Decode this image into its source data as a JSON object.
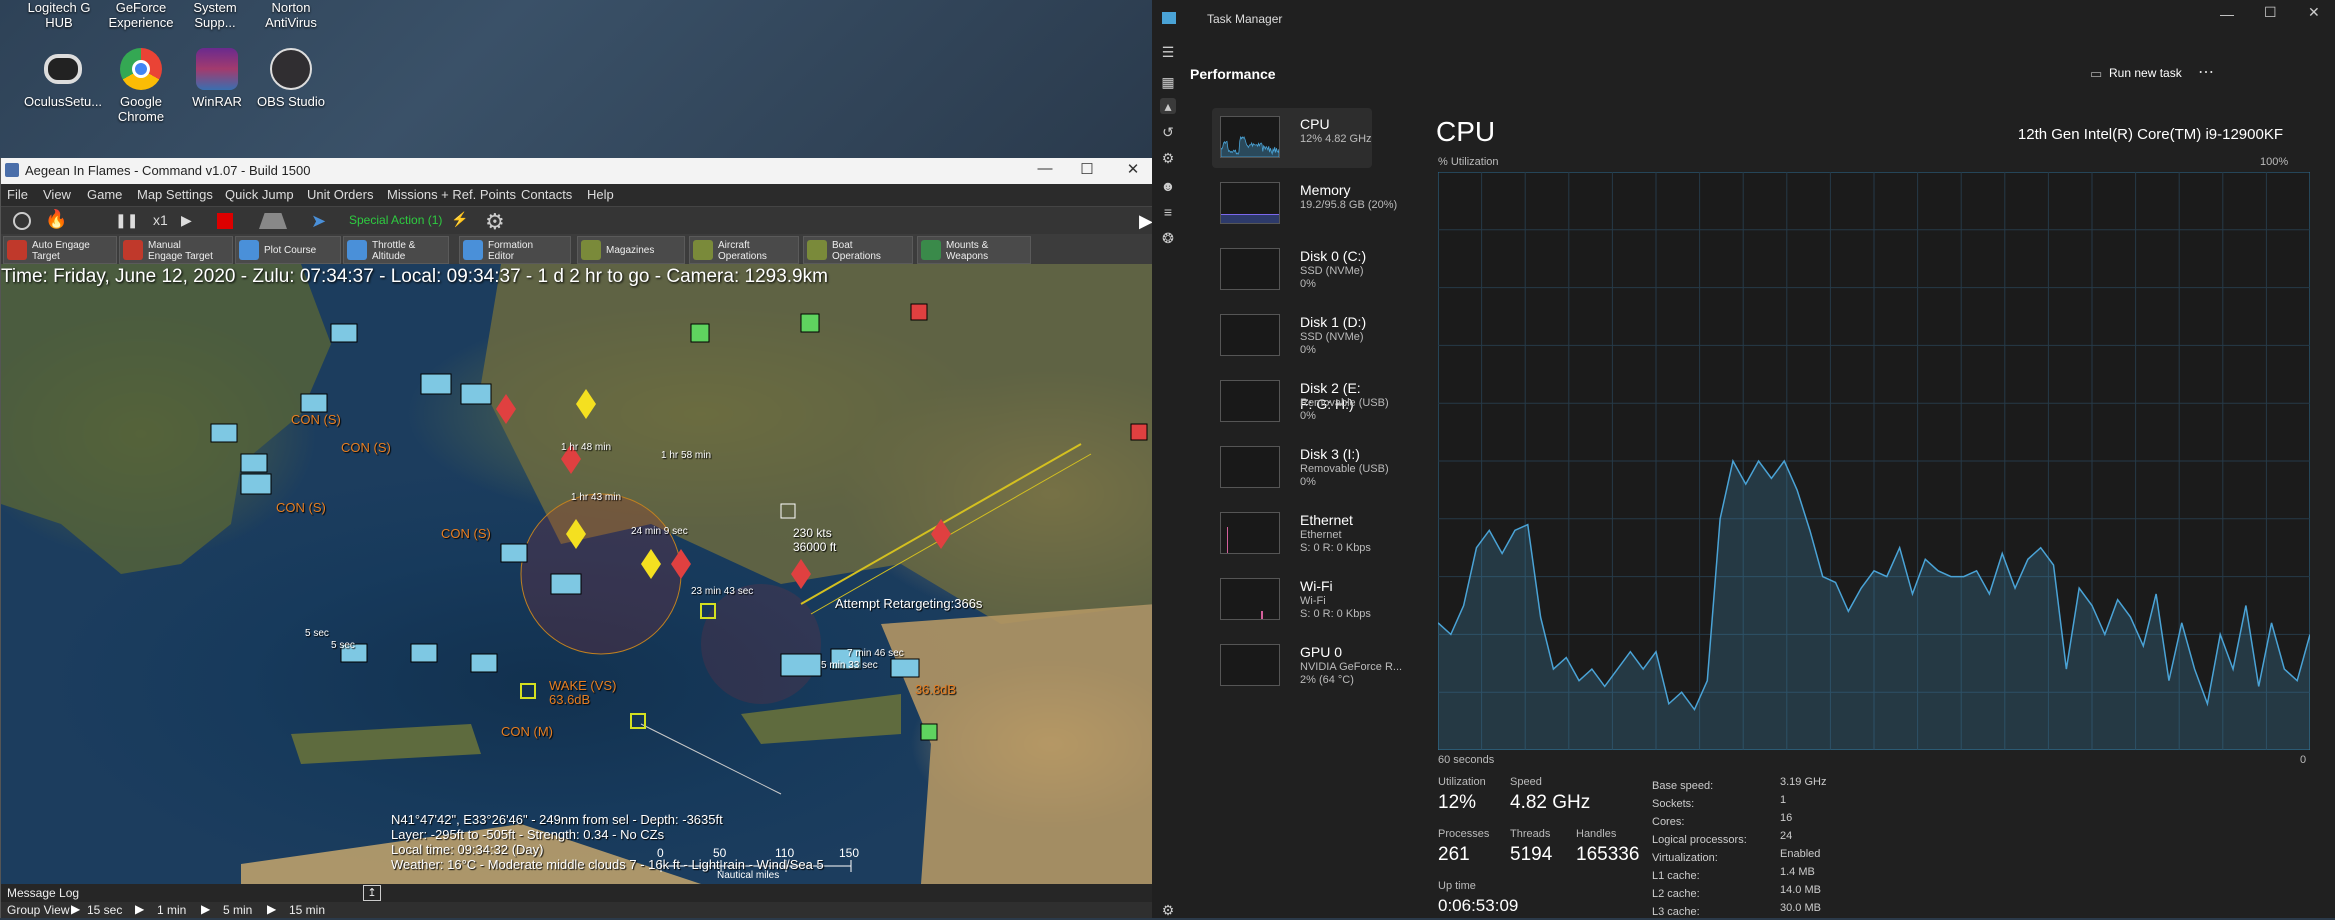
{
  "desktop": {
    "top_icons": [
      "Logitech G HUB",
      "GeForce Experience",
      "System Supp...",
      "Norton AntiVirus"
    ],
    "icons": [
      {
        "label": "OculusSetu...",
        "color": "#e7e7e7"
      },
      {
        "label": "Google Chrome",
        "color": "#4285f4"
      },
      {
        "label": "WinRAR",
        "color": "#8b2a7e"
      },
      {
        "label": "OBS Studio",
        "color": "#303030"
      }
    ]
  },
  "game": {
    "title": "Aegean In Flames - Command v1.07 - Build 1500",
    "menu": [
      "File",
      "View",
      "Game",
      "Map Settings",
      "Quick Jump",
      "Unit Orders",
      "Missions + Ref. Points",
      "Contacts",
      "Help"
    ],
    "speed_label": "x1",
    "special_action": "Special Action (1)",
    "toolbar2": [
      {
        "label": "Auto Engage\nTarget",
        "color": "#c0392b"
      },
      {
        "label": "Manual\nEngage Target",
        "color": "#c0392b"
      },
      {
        "label": "Plot Course",
        "color": "#4a90d9"
      },
      {
        "label": "Throttle &\nAltitude",
        "color": "#4a90d9"
      },
      {
        "label": "Formation\nEditor",
        "color": "#4a90d9"
      },
      {
        "label": "Magazines",
        "color": "#7a8a3a"
      },
      {
        "label": "Aircraft\nOperations",
        "color": "#7a8a3a"
      },
      {
        "label": "Boat\nOperations",
        "color": "#7a8a3a"
      },
      {
        "label": "Mounts &\nWeapons",
        "color": "#3a8a4a"
      }
    ],
    "time_line": "Time: Friday, June 12, 2020 - Zulu: 07:34:37 - Local: 09:34:37 - 1 d 2 hr to go - Camera: 1293.9km",
    "map_labels": [
      {
        "text": "CON (S)",
        "color": "#e67e22"
      },
      {
        "text": "CON (S)",
        "color": "#e67e22"
      },
      {
        "text": "CON (S)",
        "color": "#e67e22"
      },
      {
        "text": "CON (S)",
        "color": "#e67e22"
      },
      {
        "text": "WAKE (VS)",
        "color": "#e67e22"
      },
      {
        "text": "63.6dB",
        "color": "#e67e22"
      },
      {
        "text": "CON (M)",
        "color": "#e67e22"
      },
      {
        "text": "36.8dB",
        "color": "#e67e22"
      },
      {
        "text": "1 hr 48 min",
        "color": "#ffffff"
      },
      {
        "text": "1 hr 58 min",
        "color": "#ffffff"
      },
      {
        "text": "1 hr 43 min",
        "color": "#ffffff"
      },
      {
        "text": "24 min 9 sec",
        "color": "#ffffff"
      },
      {
        "text": "23 min 43 sec",
        "color": "#ffffff"
      },
      {
        "text": "230 kts",
        "color": "#ffffff"
      },
      {
        "text": "36000 ft",
        "color": "#ffffff"
      },
      {
        "text": "Attempt Retargeting:366s",
        "color": "#ffffff"
      },
      {
        "text": "7 min 46 sec",
        "color": "#ffffff"
      },
      {
        "text": "5 min 33 sec",
        "color": "#ffffff"
      },
      {
        "text": "5 sec",
        "color": "#ffffff"
      },
      {
        "text": "5 sec",
        "color": "#ffffff"
      }
    ],
    "info_lines": [
      "N41°47'42\", E33°26'46\" - 249nm from sel - Depth: -3635ft",
      "Layer: -295ft to -505ft - Strength: 0.34 - No CZs",
      "Local time: 09:34:32 (Day)",
      "Weather: 16°C - Moderate middle clouds 7 - 16k ft - Light rain - Wind/Sea 5"
    ],
    "scale_labels": [
      "0",
      "50",
      "110",
      "150"
    ],
    "scale_unit": "Nautical miles",
    "message_log": "Message Log",
    "group_view": "Group View",
    "time_steps": [
      "15 sec",
      "1 min",
      "5 min",
      "15 min"
    ]
  },
  "taskmgr": {
    "title": "Task Manager",
    "section": "Performance",
    "run_new_task": "Run new task",
    "resources": [
      {
        "name": "CPU",
        "s1": "12% 4.82 GHz",
        "s2": "",
        "color": "#4aa3d6",
        "selected": true
      },
      {
        "name": "Memory",
        "s1": "19.2/95.8 GB (20%)",
        "s2": "",
        "color": "#7b68ee",
        "selected": false
      },
      {
        "name": "Disk 0 (C:)",
        "s1": "SSD (NVMe)",
        "s2": "0%",
        "color": "#6aa84f",
        "selected": false
      },
      {
        "name": "Disk 1 (D:)",
        "s1": "SSD (NVMe)",
        "s2": "0%",
        "color": "#6aa84f",
        "selected": false
      },
      {
        "name": "Disk 2 (E: F: G: H:)",
        "s1": "Removable (USB)",
        "s2": "0%",
        "color": "#6aa84f",
        "selected": false
      },
      {
        "name": "Disk 3 (I:)",
        "s1": "Removable (USB)",
        "s2": "0%",
        "color": "#6aa84f",
        "selected": false
      },
      {
        "name": "Ethernet",
        "s1": "Ethernet",
        "s2": "S: 0 R: 0 Kbps",
        "color": "#d45f9b",
        "selected": false
      },
      {
        "name": "Wi-Fi",
        "s1": "Wi-Fi",
        "s2": "S: 0 R: 0 Kbps",
        "color": "#d45f9b",
        "selected": false
      },
      {
        "name": "GPU 0",
        "s1": "NVIDIA GeForce R...",
        "s2": "2% (64 °C)",
        "color": "#4aa3d6",
        "selected": false
      }
    ],
    "cpu": {
      "heading": "CPU",
      "model": "12th Gen Intel(R) Core(TM) i9-12900KF",
      "util_label": "% Utilization",
      "max_label": "100%",
      "time_label": "60 seconds",
      "min_label": "0",
      "history": [
        22,
        20,
        25,
        35,
        38,
        34,
        38,
        39,
        23,
        14,
        16,
        12,
        14,
        11,
        14,
        17,
        14,
        17,
        8,
        10,
        7,
        12,
        40,
        50,
        46,
        50,
        47,
        50,
        45,
        38,
        30,
        29,
        24,
        28,
        31,
        30,
        35,
        27,
        33,
        31,
        30,
        30,
        31,
        27,
        34,
        28,
        33,
        35,
        32,
        14,
        28,
        25,
        20,
        26,
        23,
        18,
        27,
        12,
        22,
        14,
        8,
        20,
        14,
        25,
        11,
        22,
        14,
        12,
        20
      ],
      "utilization_label": "Utilization",
      "utilization": "12%",
      "speed_label": "Speed",
      "speed": "4.82 GHz",
      "processes_label": "Processes",
      "processes": "261",
      "threads_label": "Threads",
      "threads": "5194",
      "handles_label": "Handles",
      "handles": "165336",
      "uptime_label": "Up time",
      "uptime": "0:06:53:09",
      "details": [
        {
          "k": "Base speed:",
          "v": "3.19 GHz"
        },
        {
          "k": "Sockets:",
          "v": "1"
        },
        {
          "k": "Cores:",
          "v": "16"
        },
        {
          "k": "Logical processors:",
          "v": "24"
        },
        {
          "k": "Virtualization:",
          "v": "Enabled"
        },
        {
          "k": "L1 cache:",
          "v": "1.4 MB"
        },
        {
          "k": "L2 cache:",
          "v": "14.0 MB"
        },
        {
          "k": "L3 cache:",
          "v": "30.0 MB"
        }
      ]
    }
  }
}
